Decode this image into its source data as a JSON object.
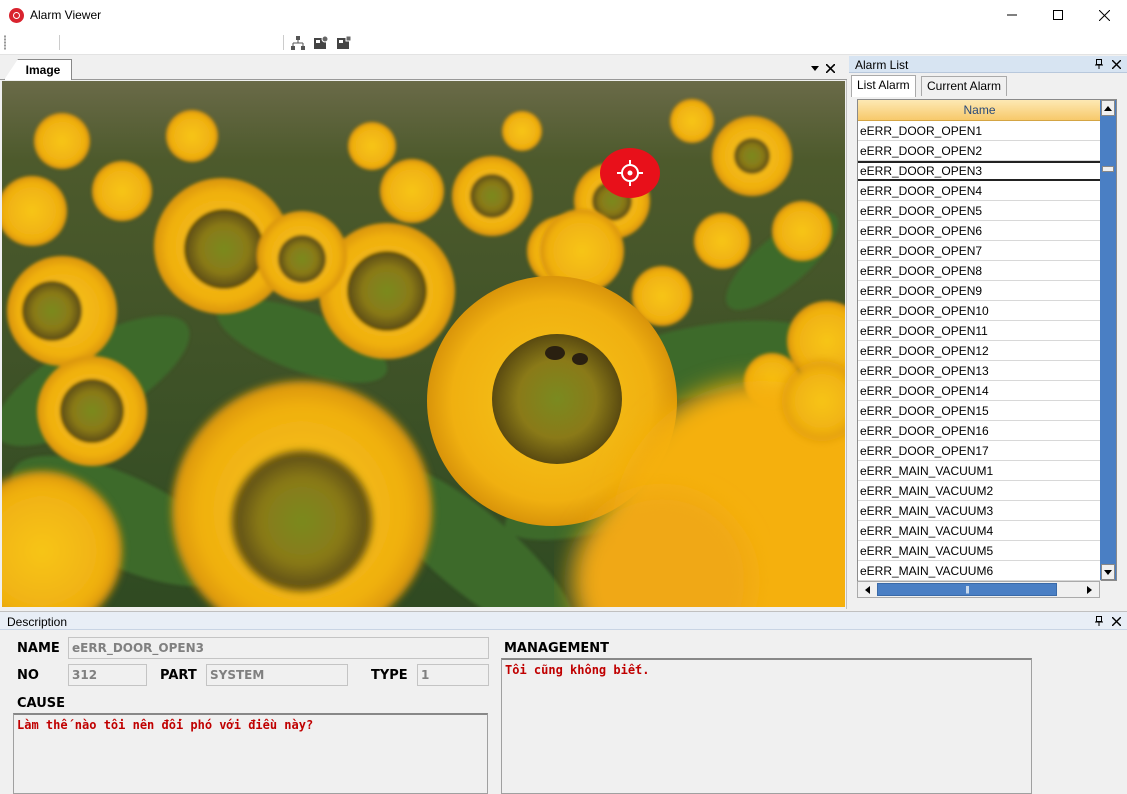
{
  "window": {
    "title": "Alarm Viewer"
  },
  "image_panel": {
    "tab_label": "Image"
  },
  "alarm_list": {
    "title": "Alarm List",
    "tabs": [
      "List Alarm",
      "Current Alarm"
    ],
    "column_header": "Name",
    "selected": "eERR_DOOR_OPEN3",
    "items": [
      "eERR_DOOR_OPEN1",
      "eERR_DOOR_OPEN2",
      "eERR_DOOR_OPEN3",
      "eERR_DOOR_OPEN4",
      "eERR_DOOR_OPEN5",
      "eERR_DOOR_OPEN6",
      "eERR_DOOR_OPEN7",
      "eERR_DOOR_OPEN8",
      "eERR_DOOR_OPEN9",
      "eERR_DOOR_OPEN10",
      "eERR_DOOR_OPEN11",
      "eERR_DOOR_OPEN12",
      "eERR_DOOR_OPEN13",
      "eERR_DOOR_OPEN14",
      "eERR_DOOR_OPEN15",
      "eERR_DOOR_OPEN16",
      "eERR_DOOR_OPEN17",
      "eERR_MAIN_VACUUM1",
      "eERR_MAIN_VACUUM2",
      "eERR_MAIN_VACUUM3",
      "eERR_MAIN_VACUUM4",
      "eERR_MAIN_VACUUM5",
      "eERR_MAIN_VACUUM6"
    ]
  },
  "description": {
    "title": "Description",
    "name_label": "NAME",
    "name_value": "eERR_DOOR_OPEN3",
    "no_label": "NO",
    "no_value": "312",
    "part_label": "PART",
    "part_value": "SYSTEM",
    "type_label": "TYPE",
    "type_value": "1",
    "cause_label": "CAUSE",
    "cause_text": "Làm thế nào tôi nên đối phó với điều này?",
    "management_label": "MANAGEMENT",
    "management_text": "Tôi cũng không biết."
  },
  "icons": {
    "app": "alarm-app-icon",
    "target": "crosshair-target-icon"
  },
  "colors": {
    "accent_blue": "#4a7fc4",
    "header_gold": "#f7c96b",
    "alert_red": "#c00000",
    "target_red": "#e8101a"
  }
}
